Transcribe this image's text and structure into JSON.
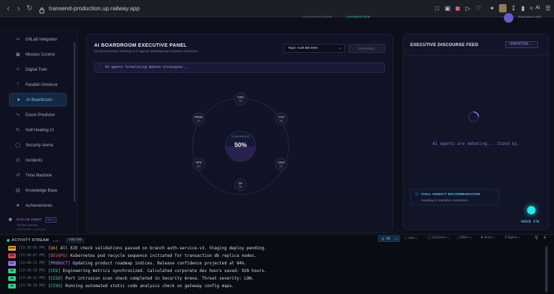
{
  "browser": {
    "url": "transend-production.up.railway.app",
    "toolbar_ai_label": "AI"
  },
  "app": {
    "topbar": {
      "item1": "ARCHITECTURE",
      "item2": "CONNECTED",
      "user": "Executive Lead"
    }
  },
  "sidebar": {
    "items": [
      {
        "label": "GitLab Integrator",
        "icon": "link"
      },
      {
        "label": "Mission Control",
        "icon": "monitor"
      },
      {
        "label": "Digital Twin",
        "icon": "share"
      },
      {
        "label": "Parallel Universe",
        "icon": "branch"
      },
      {
        "label": "AI Boardroom",
        "icon": "users"
      },
      {
        "label": "Doom Predictor",
        "icon": "pulse"
      },
      {
        "label": "Self-Healing CI",
        "icon": "refresh"
      },
      {
        "label": "Security Arena",
        "icon": "shield"
      },
      {
        "label": "Incidents",
        "icon": "clock"
      },
      {
        "label": "Time Machine",
        "icon": "history"
      },
      {
        "label": "Knowledge Base",
        "icon": "book"
      },
      {
        "label": "Achievements",
        "icon": "trophy"
      }
    ],
    "orbit": {
      "title": "GITLAB ORBIT",
      "badge": "BETA",
      "line1": "143 files indexed",
      "line2": "1945 nodes • 3 commits"
    }
  },
  "boardroom": {
    "title": "AI BOARDROOM EXECUTIVE PANEL",
    "subtitle": "Virtual executive meeting of AI agents debating key business decisions.",
    "topic_select": "Topic: Auth DB Debt",
    "generate_button": "Generating...",
    "status": "AI agents formulating debate strategies...",
    "consensus_label": "CONSENSUS",
    "consensus_value": "50%",
    "agents": [
      {
        "name": "CEO",
        "value": "?"
      },
      {
        "name": "CTO",
        "value": "?"
      },
      {
        "name": "CISO",
        "value": "?"
      },
      {
        "name": "QA",
        "value": "?"
      },
      {
        "name": "OPS",
        "value": "?"
      },
      {
        "name": "PROD",
        "value": "?"
      }
    ]
  },
  "feed": {
    "title": "EXECUTIVE DISCOURSE FEED",
    "badge": "GENERATING...",
    "waiting": "AI agents are debating... Stand by.",
    "verdict_title": "FINAL VERDICT RECOMMENDATION",
    "verdict_text": "Awaiting AI executive consensus...",
    "voice_label": "VOICE CTO"
  },
  "activity": {
    "title": "ACTIVITY STREAM",
    "live": "LIVE",
    "count": "100/100",
    "filters": [
      {
        "label": "All",
        "count": "100"
      },
      {
        "label": "Info",
        "count": "27"
      },
      {
        "label": "Success",
        "count": "23"
      },
      {
        "label": "Warn",
        "count": "18"
      },
      {
        "label": "Error",
        "count": "17"
      },
      {
        "label": "Agent",
        "count": "15"
      }
    ],
    "logs": [
      {
        "type": "WARN",
        "color": "#e8a93a",
        "time": "[13:38:05 PM]",
        "tag": "[QA]",
        "tag_color": "#e8a93a",
        "text": "All E2E check validations passed on branch auth-service-v3. Staging deploy pending."
      },
      {
        "type": "ERR",
        "color": "#e0485c",
        "time": "[13:38:07 PM]",
        "tag": "[DEVOPS]",
        "tag_color": "#ef5a6f",
        "text": "Kubernetes pod recycle sequence initiated for transaction db replica nodes."
      },
      {
        "type": "AGT",
        "color": "#a774f2",
        "time": "[13:38:11 PM]",
        "tag": "[PRODUCT]",
        "tag_color": "#b58af5",
        "text": "Updating product roadmap indices. Release confidence projected at 84%."
      },
      {
        "type": "OK",
        "color": "#3ec98a",
        "time": "[13:38:18 PM]",
        "tag": "[CEO]",
        "tag_color": "#4fd69a",
        "text": "Engineering metrics synchronized. Calculated corporate dev hours saved: 928 hours."
      },
      {
        "type": "OK",
        "color": "#3ec98a",
        "time": "[13:38:22 PM]",
        "tag": "[CISO]",
        "tag_color": "#4fd69a",
        "text": "Port intrusion scan check completed in Security Arena. Threat severity: LOW."
      },
      {
        "type": "OK",
        "color": "#3ec98a",
        "time": "[13:38:29 PM]",
        "tag": "[CISO]",
        "tag_color": "#4fd69a",
        "text": "Running automated static code analysis check on gateway config maps."
      }
    ]
  }
}
